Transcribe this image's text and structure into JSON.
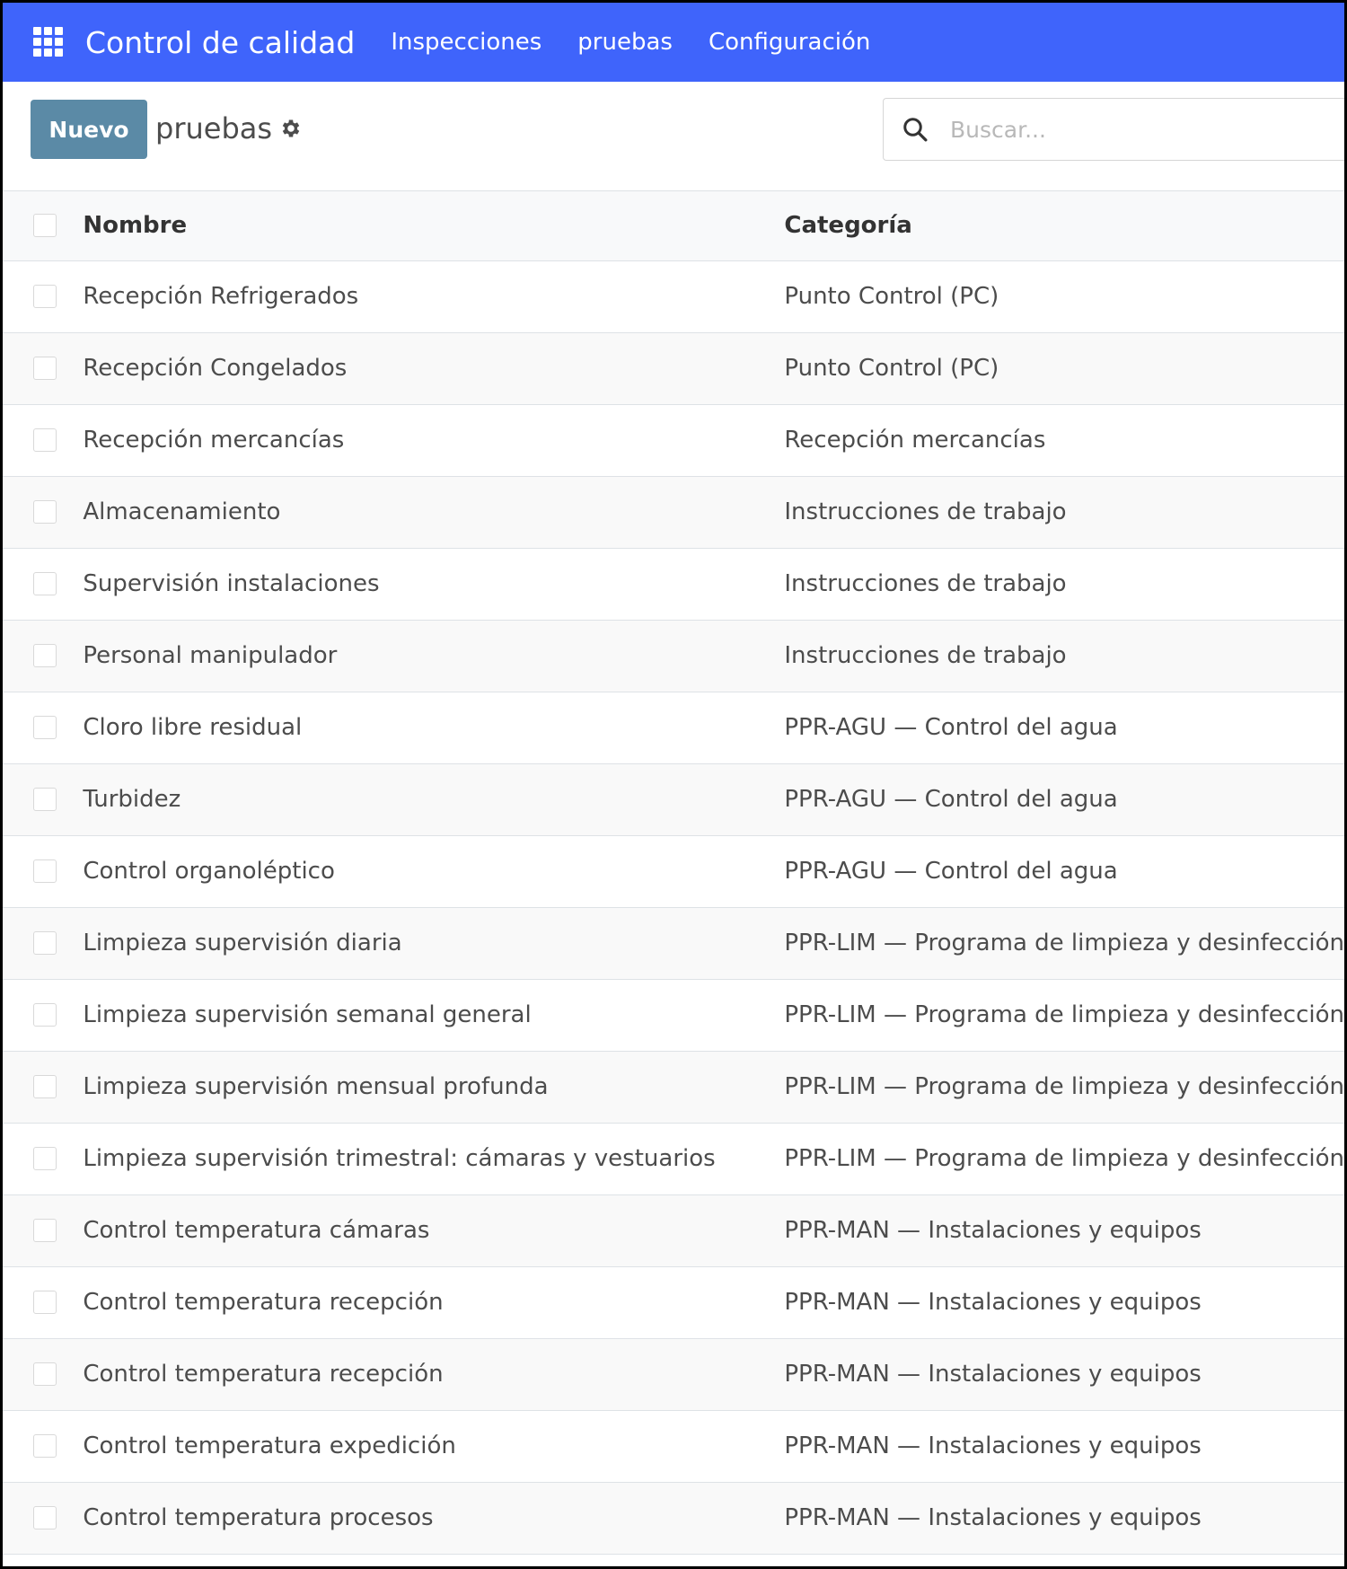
{
  "navbar": {
    "app_title": "Control de calidad",
    "menu": [
      "Inspecciones",
      "pruebas",
      "Configuración"
    ],
    "color": "#3f64fb"
  },
  "control_panel": {
    "new_button_label": "Nuevo",
    "new_button_color": "#5b8aa6",
    "breadcrumb": "pruebas",
    "search_placeholder": "Buscar..."
  },
  "table": {
    "columns": [
      "Nombre",
      "Categoría"
    ],
    "rows": [
      {
        "name": "Recepción Refrigerados",
        "category": "Punto Control (PC)"
      },
      {
        "name": "Recepción Congelados",
        "category": "Punto Control (PC)"
      },
      {
        "name": "Recepción mercancías",
        "category": "Recepción mercancías"
      },
      {
        "name": "Almacenamiento",
        "category": "Instrucciones de trabajo"
      },
      {
        "name": "Supervisión instalaciones",
        "category": "Instrucciones de trabajo"
      },
      {
        "name": "Personal manipulador",
        "category": "Instrucciones de trabajo"
      },
      {
        "name": "Cloro libre residual",
        "category": "PPR-AGU — Control del agua"
      },
      {
        "name": "Turbidez",
        "category": "PPR-AGU — Control del agua"
      },
      {
        "name": "Control organoléptico",
        "category": "PPR-AGU — Control del agua"
      },
      {
        "name": "Limpieza supervisión diaria",
        "category": "PPR-LIM — Programa de limpieza y desinfección"
      },
      {
        "name": "Limpieza supervisión semanal general",
        "category": "PPR-LIM — Programa de limpieza y desinfección"
      },
      {
        "name": "Limpieza supervisión mensual profunda",
        "category": "PPR-LIM — Programa de limpieza y desinfección"
      },
      {
        "name": "Limpieza supervisión trimestral: cámaras y vestuarios",
        "category": "PPR-LIM — Programa de limpieza y desinfección"
      },
      {
        "name": "Control temperatura cámaras",
        "category": "PPR-MAN — Instalaciones y equipos"
      },
      {
        "name": "Control temperatura recepción",
        "category": "PPR-MAN — Instalaciones y equipos"
      },
      {
        "name": "Control temperatura recepción",
        "category": "PPR-MAN — Instalaciones y equipos"
      },
      {
        "name": "Control temperatura expedición",
        "category": "PPR-MAN — Instalaciones y equipos"
      },
      {
        "name": "Control temperatura procesos",
        "category": "PPR-MAN — Instalaciones y equipos"
      }
    ]
  }
}
